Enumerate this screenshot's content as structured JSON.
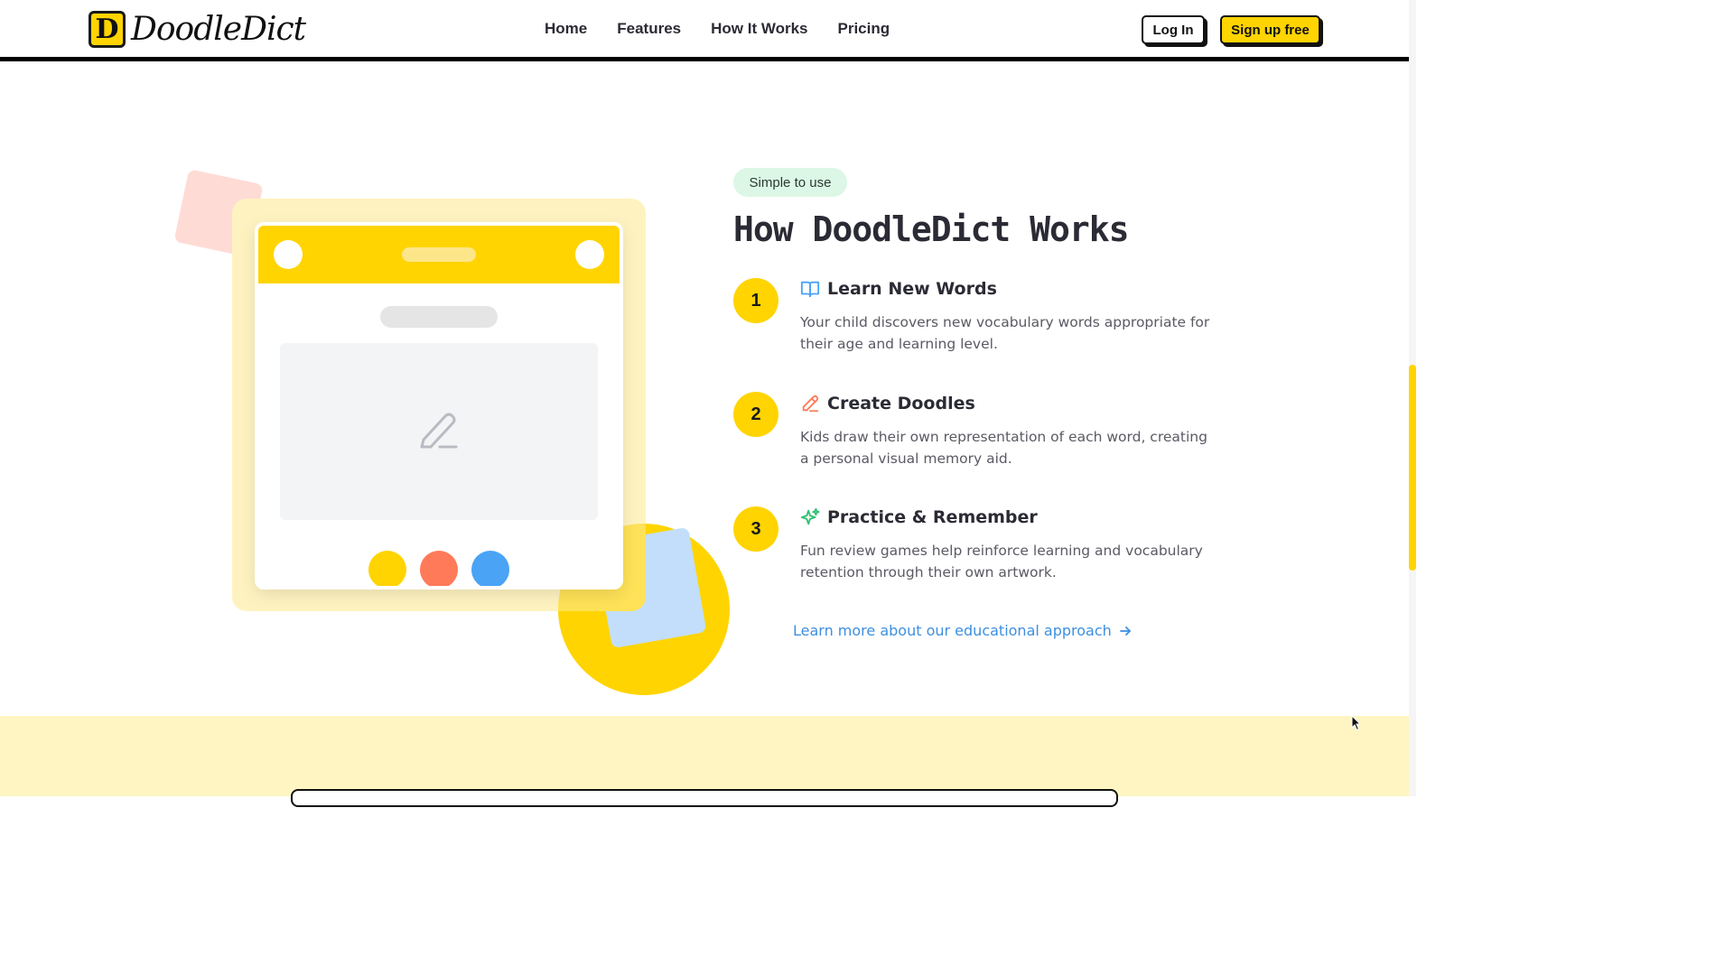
{
  "header": {
    "brand": "DoodleDict",
    "logo_letter": "D",
    "nav": [
      "Home",
      "Features",
      "How It Works",
      "Pricing"
    ],
    "login_label": "Log In",
    "signup_label": "Sign up free"
  },
  "how_it_works": {
    "badge": "Simple to use",
    "title": "How DoodleDict Works",
    "steps": [
      {
        "number": "1",
        "icon": "book-open-icon",
        "title": "Learn New Words",
        "description": "Your child discovers new vocabulary words appropriate for their age and learning level."
      },
      {
        "number": "2",
        "icon": "pencil-icon",
        "title": "Create Doodles",
        "description": "Kids draw their own representation of each word, creating a personal visual memory aid."
      },
      {
        "number": "3",
        "icon": "sparkles-icon",
        "title": "Practice & Remember",
        "description": "Fun review games help reinforce learning and vocabulary retention through their own artwork."
      }
    ],
    "link_label": "Learn more about our educational approach"
  },
  "colors": {
    "accent": "#ffd400",
    "badge_bg": "#dcf7e5",
    "link": "#3d8fe0",
    "swatch_yellow": "#ffd400",
    "swatch_coral": "#ff7a59",
    "swatch_blue": "#4aa3f5",
    "band": "#fef5c2"
  }
}
